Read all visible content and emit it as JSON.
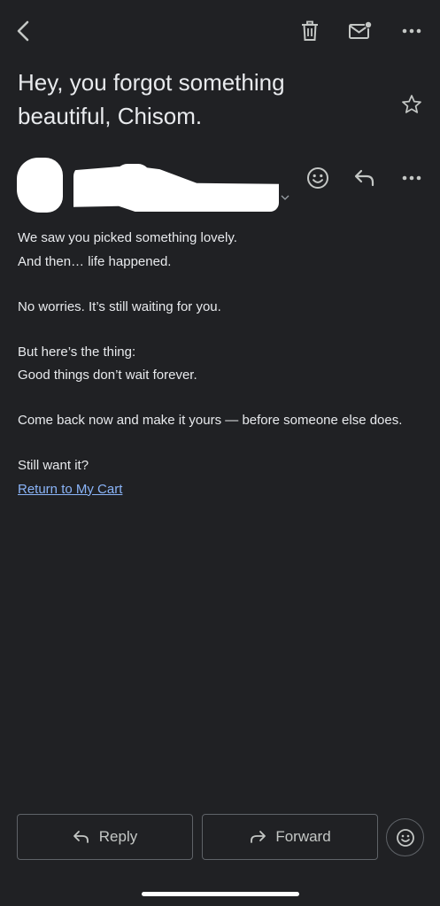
{
  "toolbar": {
    "back_icon": "chevron-left-icon",
    "delete_icon": "trash-icon",
    "mark_unread_icon": "mail-dot-icon",
    "more_icon": "more-horizontal-icon"
  },
  "email": {
    "subject": "Hey, you forgot something beautiful, Chisom.",
    "star_icon": "star-outline-icon",
    "sender_redacted": true,
    "body": [
      [
        "We saw you picked something lovely.",
        "And then… life happened."
      ],
      [
        "No worries. It’s still waiting for you."
      ],
      [
        "But here’s the thing:",
        "Good things don’t wait forever."
      ],
      [
        "Come back now and make it yours — before someone else does."
      ]
    ],
    "closing": "Still want it?",
    "cta_link": "Return to My Cart"
  },
  "actions": {
    "reply_label": "Reply",
    "forward_label": "Forward"
  },
  "colors": {
    "background": "#202124",
    "text": "#e8eaed",
    "icon": "#c4c7c5",
    "link": "#8ab4f8",
    "border": "#5f6368"
  }
}
